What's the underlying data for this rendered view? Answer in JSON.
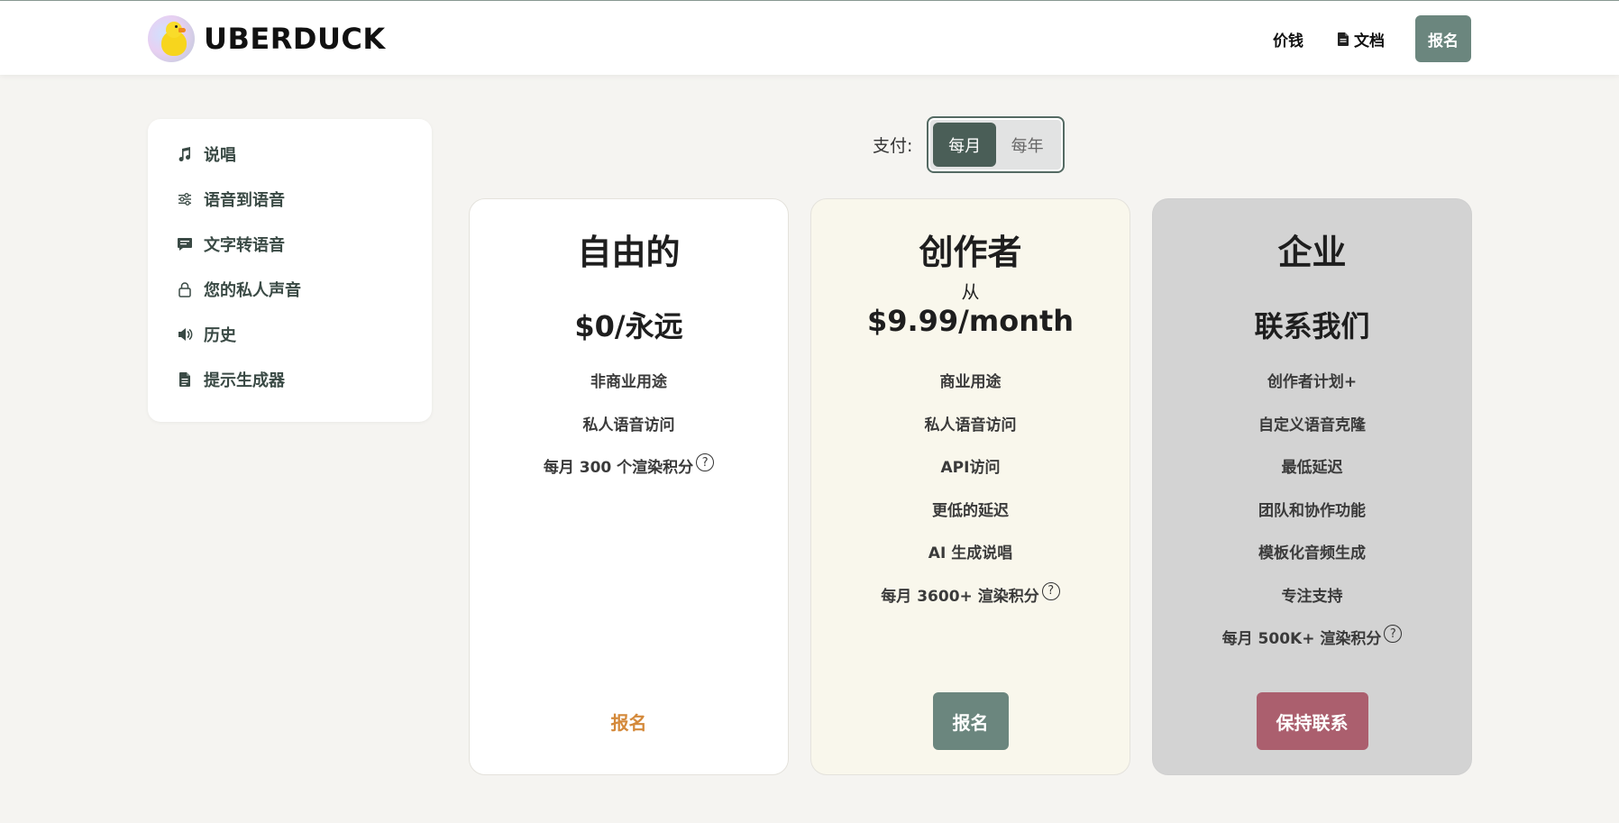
{
  "brand": {
    "name": "UBERDUCK",
    "logo_icon": "duck-logo"
  },
  "nav": {
    "pricing": "价钱",
    "docs": "文档",
    "signup": "报名"
  },
  "sidebar": {
    "items": [
      {
        "label": "说唱",
        "icon": "music-note-icon"
      },
      {
        "label": "语音到语音",
        "icon": "sliders-icon"
      },
      {
        "label": "文字转语音",
        "icon": "chat-bubble-icon"
      },
      {
        "label": "您的私人声音",
        "icon": "lock-icon"
      },
      {
        "label": "历史",
        "icon": "speaker-icon"
      },
      {
        "label": "提示生成器",
        "icon": "document-icon"
      }
    ]
  },
  "billing": {
    "label": "支付:",
    "options": [
      "每月",
      "每年"
    ],
    "selected": "每月"
  },
  "plans": [
    {
      "title": "自由的",
      "price": "$0/永远",
      "features": [
        "非商业用途",
        "私人语音访问",
        "每月 300 个渲染积分"
      ],
      "cta": "报名"
    },
    {
      "title": "创作者",
      "from": "从",
      "price": "$9.99/month",
      "features": [
        "商业用途",
        "私人语音访问",
        "API访问",
        "更低的延迟",
        "AI 生成说唱",
        "每月 3600+ 渲染积分"
      ],
      "cta": "报名"
    },
    {
      "title": "企业",
      "price": "联系我们",
      "features": [
        "创作者计划+",
        "自定义语音克隆",
        "最低延迟",
        "团队和协作功能",
        "模板化音频生成",
        "专注支持",
        "每月 500K+ 渲染积分"
      ],
      "cta": "保持联系"
    }
  ],
  "help_glyph": "?",
  "colors": {
    "accent_green": "#6b867e",
    "accent_rose": "#ab5f6e",
    "link_orange": "#d4893a"
  }
}
